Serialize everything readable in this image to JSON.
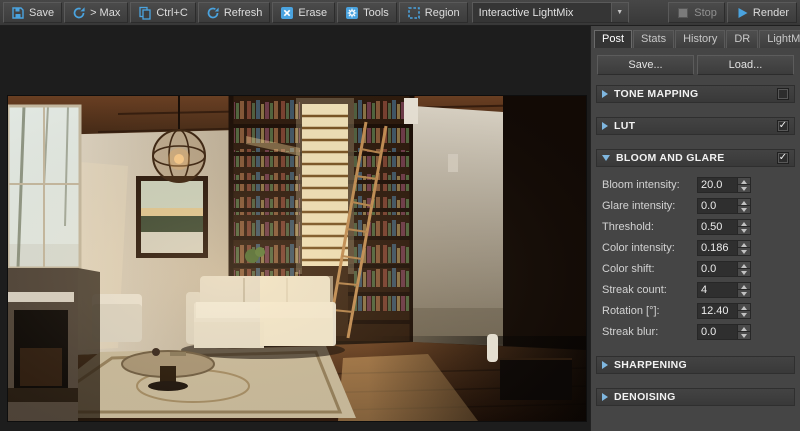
{
  "toolbar": {
    "buttons": [
      {
        "label": "Save",
        "icon": "save-icon"
      },
      {
        "label": "> Max",
        "icon": "vray-max-icon"
      },
      {
        "label": "Ctrl+C",
        "icon": "copy-icon"
      },
      {
        "label": "Refresh",
        "icon": "refresh-icon"
      },
      {
        "label": "Erase",
        "icon": "erase-icon"
      },
      {
        "label": "Tools",
        "icon": "tools-icon"
      },
      {
        "label": "Region",
        "icon": "region-icon"
      }
    ],
    "render_mode_dropdown": {
      "value": "Interactive LightMix"
    },
    "stop_label": "Stop",
    "render_label": "Render"
  },
  "panel": {
    "tabs": [
      {
        "label": "Post",
        "active": true
      },
      {
        "label": "Stats",
        "active": false
      },
      {
        "label": "History",
        "active": false
      },
      {
        "label": "DR",
        "active": false
      },
      {
        "label": "LightMix",
        "active": false
      }
    ],
    "save_label": "Save...",
    "load_label": "Load...",
    "sections": [
      {
        "title": "TONE MAPPING",
        "expanded": false,
        "has_checkbox": true,
        "checked": false
      },
      {
        "title": "LUT",
        "expanded": false,
        "has_checkbox": true,
        "checked": true
      },
      {
        "title": "BLOOM AND GLARE",
        "expanded": true,
        "has_checkbox": true,
        "checked": true,
        "params": [
          {
            "label": "Bloom intensity:",
            "value": "20.0"
          },
          {
            "label": "Glare intensity:",
            "value": "0.0"
          },
          {
            "label": "Threshold:",
            "value": "0.50"
          },
          {
            "label": "Color intensity:",
            "value": "0.186"
          },
          {
            "label": "Color shift:",
            "value": "0.0"
          },
          {
            "label": "Streak count:",
            "value": "4"
          },
          {
            "label": "Rotation [°]:",
            "value": "12.40"
          },
          {
            "label": "Streak blur:",
            "value": "0.0"
          }
        ]
      },
      {
        "title": "SHARPENING",
        "expanded": false,
        "has_checkbox": false,
        "checked": false
      },
      {
        "title": "DENOISING",
        "expanded": false,
        "has_checkbox": false,
        "checked": false
      }
    ]
  },
  "viewport": {
    "description": "Interior living-room render: white sofa, bookshelf wall with ladder, pendant lamp, fireplace, oriental rug"
  },
  "colors": {
    "accent_blue": "#4aa3df",
    "panel_bg": "#454545",
    "toolbar_bg": "#3d3d3d",
    "canvas_bg": "#1d1d1d"
  }
}
